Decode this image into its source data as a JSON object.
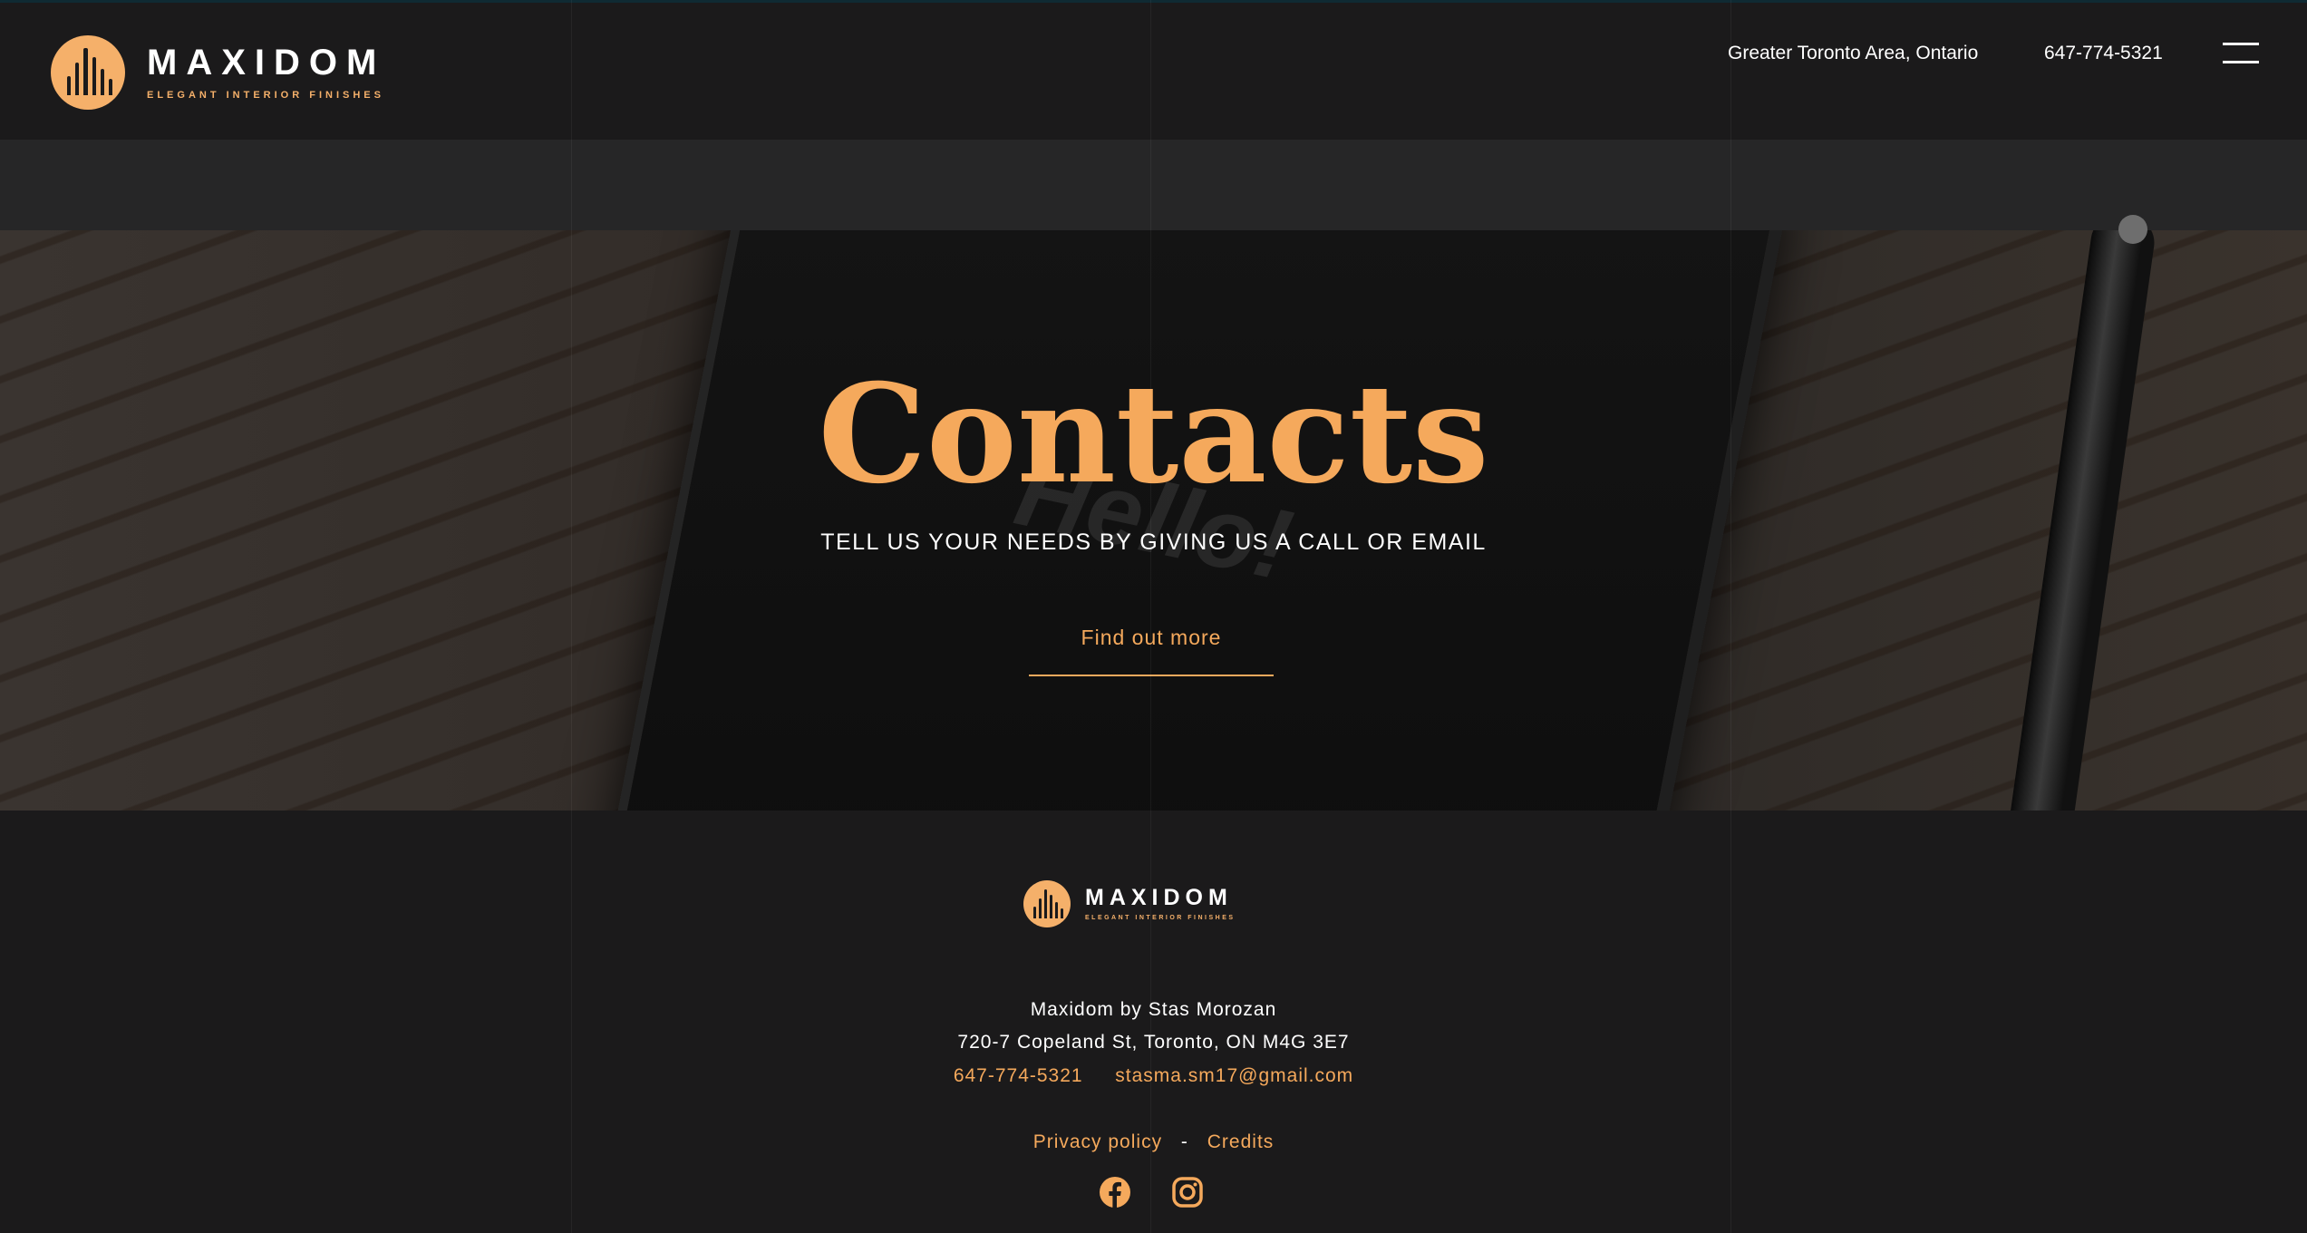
{
  "header": {
    "logo_word": "MAXIDOM",
    "logo_tagline": "ELEGANT INTERIOR FINISHES",
    "location": "Greater Toronto Area, Ontario",
    "phone": "647-774-5321",
    "menu_icon": "hamburger-icon"
  },
  "hero": {
    "title": "Contacts",
    "subtitle": "TELL US YOUR NEEDS BY GIVING US A CALL OR EMAIL",
    "button_label": "Find out more",
    "background_text": "Hello!"
  },
  "footer": {
    "logo_word": "MAXIDOM",
    "logo_tagline": "ELEGANT INTERIOR FINISHES",
    "company": "Maxidom by Stas Morozan",
    "address": "720-7 Copeland St, Toronto, ON M4G 3E7",
    "phone": "647-774-5321",
    "email": "stasma.sm17@gmail.com",
    "privacy_label": "Privacy policy",
    "separator": "-",
    "credits_label": "Credits",
    "socials": [
      "facebook-icon",
      "instagram-icon"
    ]
  },
  "colors": {
    "accent": "#f5a95c",
    "background": "#1b1a1b",
    "band": "#262627"
  }
}
